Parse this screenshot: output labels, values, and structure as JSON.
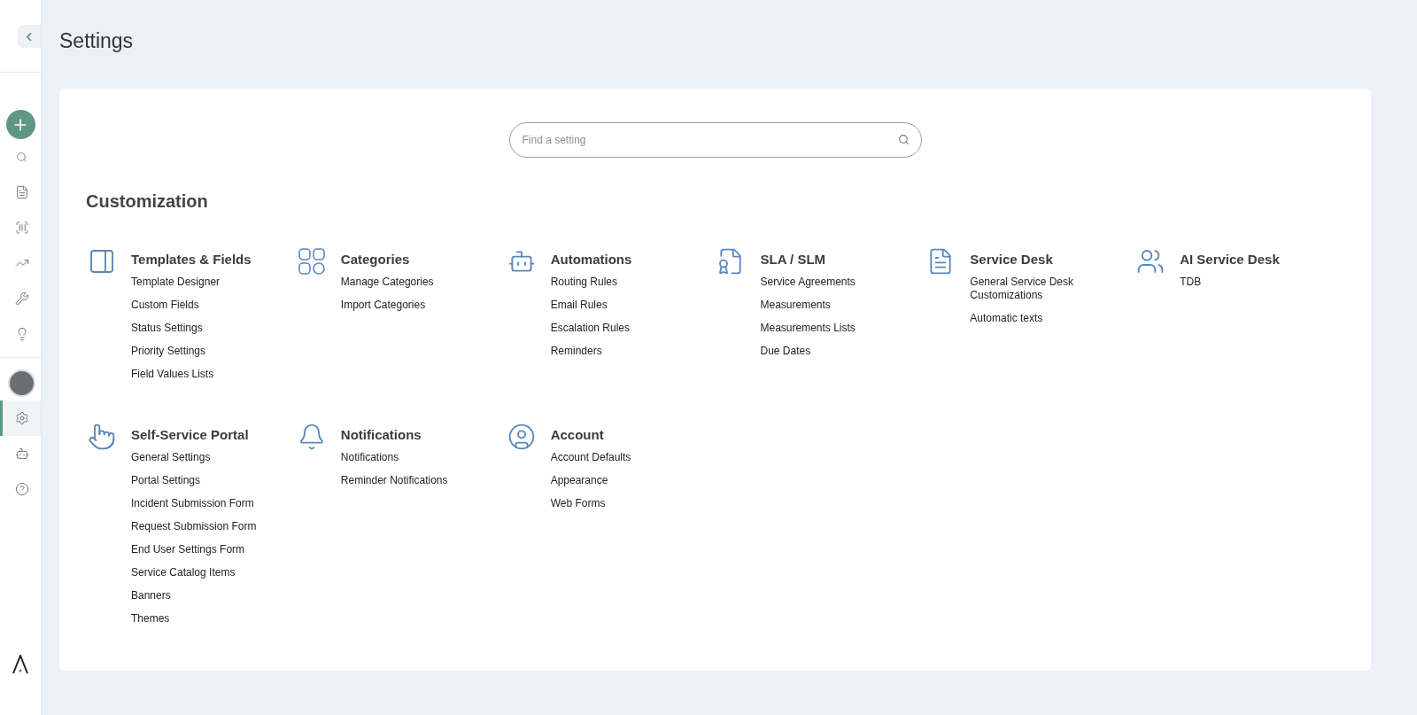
{
  "sidebar": {
    "back_label": "‹",
    "nav": [
      {
        "kind": "search",
        "selected": false
      },
      {
        "kind": "tickets",
        "selected": false
      },
      {
        "kind": "scanner",
        "selected": false
      },
      {
        "kind": "reports",
        "selected": false
      },
      {
        "kind": "tools",
        "selected": false
      },
      {
        "kind": "ideas",
        "selected": false
      },
      {
        "kind": "avatar",
        "selected": false
      },
      {
        "kind": "settings",
        "selected": true
      },
      {
        "kind": "bot",
        "selected": false
      },
      {
        "kind": "help",
        "selected": false
      }
    ]
  },
  "page": {
    "title": "Settings"
  },
  "search": {
    "placeholder": "Find a setting"
  },
  "section": {
    "title": "Customization",
    "groups": [
      {
        "kind": "templates",
        "title": "Templates & Fields",
        "links": [
          "Template Designer",
          "Custom Fields",
          "Status Settings",
          "Priority Settings",
          "Field Values Lists"
        ]
      },
      {
        "kind": "categories",
        "title": "Categories",
        "links": [
          "Manage Categories",
          "Import Categories"
        ]
      },
      {
        "kind": "automations",
        "title": "Automations",
        "links": [
          "Routing Rules",
          "Email Rules",
          "Escalation Rules",
          "Reminders"
        ]
      },
      {
        "kind": "sla",
        "title": "SLA / SLM",
        "links": [
          "Service Agreements",
          "Measurements",
          "Measurements Lists",
          "Due Dates"
        ]
      },
      {
        "kind": "servicedesk",
        "title": "Service Desk",
        "links": [
          "General Service Desk Customizations",
          "Automatic texts"
        ]
      },
      {
        "kind": "ai",
        "title": "AI Service Desk",
        "links": [
          "TDB"
        ]
      },
      {
        "kind": "portal",
        "title": "Self-Service Portal",
        "links": [
          "General Settings",
          "Portal Settings",
          "Incident Submission Form",
          "Request Submission Form",
          "End User Settings Form",
          "Service Catalog Items",
          "Banners",
          "Themes"
        ]
      },
      {
        "kind": "notifications",
        "title": "Notifications",
        "links": [
          "Notifications",
          "Reminder Notifications"
        ]
      },
      {
        "kind": "account",
        "title": "Account",
        "links": [
          "Account Defaults",
          "Appearance",
          "Web Forms"
        ]
      }
    ]
  }
}
